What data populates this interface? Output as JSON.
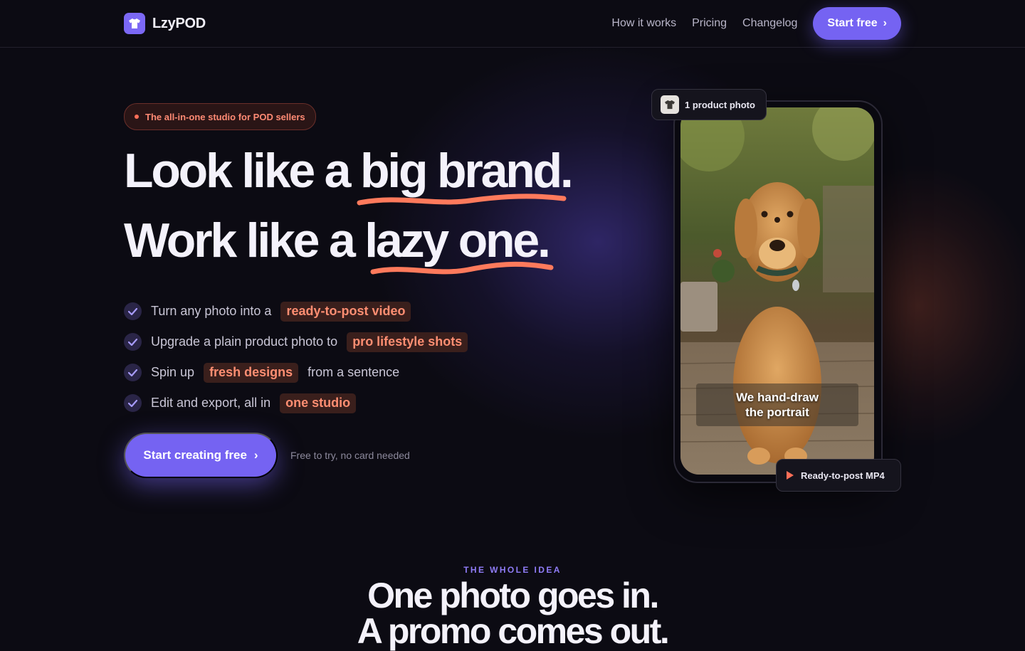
{
  "header": {
    "brand": "LzyPOD",
    "nav": [
      "How it works",
      "Pricing",
      "Changelog"
    ],
    "cta_label": "Start free"
  },
  "hero": {
    "badge": "The all-in-one studio for POD sellers",
    "line1_prefix": "Look like a ",
    "line1_emph": "big brand.",
    "line2_prefix": "Work like a ",
    "line2_emph": "lazy one.",
    "features": [
      {
        "before": "Turn any photo into a",
        "highlight": "ready-to-post video",
        "after": ""
      },
      {
        "before": "Upgrade a plain product photo to",
        "highlight": "pro lifestyle shots",
        "after": ""
      },
      {
        "before": "Spin up",
        "highlight": "fresh designs",
        "after": "from a sentence"
      },
      {
        "before": "Edit and export, all in",
        "highlight": "one studio",
        "after": ""
      }
    ],
    "cta_label": "Start creating free",
    "cta_note": "Free to try, no card needed"
  },
  "preview": {
    "input_chip": "1 product photo",
    "caption_line1": "We hand-draw",
    "caption_line2": "the portrait",
    "output_chip": "Ready-to-post MP4"
  },
  "section": {
    "eyebrow": "THE WHOLE IDEA",
    "title_line1": "One photo goes in.",
    "title_line2": "A promo comes out."
  },
  "colors": {
    "background": "#0c0b13",
    "accent": "#7563f2",
    "highlight": "#ff8e72",
    "underline": "#ff7a5c"
  }
}
